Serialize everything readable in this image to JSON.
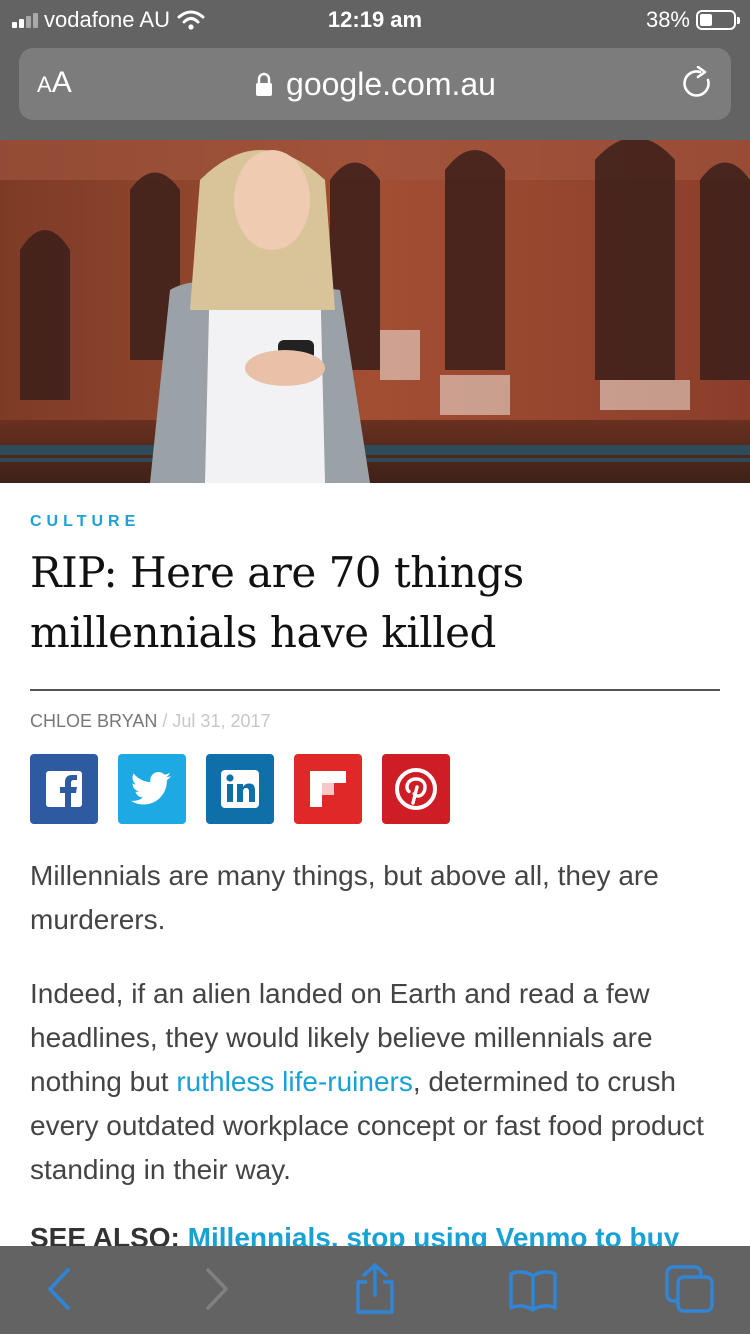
{
  "status_bar": {
    "carrier": "vodafone AU",
    "time": "12:19 am",
    "battery_percent": "38%",
    "battery_level": 0.38
  },
  "browser": {
    "aa_label_small": "A",
    "aa_label_big": "A",
    "url": "google.com.au"
  },
  "article": {
    "category": "CULTURE",
    "headline": "RIP: Here are 70 things millennials have killed",
    "author": "CHLOE BRYAN",
    "byline_separator": "/",
    "date": "Jul 31, 2017",
    "paragraph1": "Millennials are many things, but above all, they are murderers.",
    "paragraph2_before": "Indeed, if an alien landed on Earth and read a few headlines, they would likely believe millennials are nothing but ",
    "paragraph2_link": "ruthless life-ruiners",
    "paragraph2_after": ", determined to crush every outdated workplace concept or fast food product standing in their way.",
    "see_also_label": "SEE ALSO:",
    "see_also_link": "Millennials, stop using Venmo to buy"
  },
  "share": [
    {
      "name": "facebook",
      "color": "#2d5aa0",
      "icon": "facebook-icon"
    },
    {
      "name": "twitter",
      "color": "#1da9e3",
      "icon": "twitter-icon"
    },
    {
      "name": "linkedin",
      "color": "#0f6fa8",
      "icon": "linkedin-icon"
    },
    {
      "name": "flipboard",
      "color": "#e12828",
      "icon": "flipboard-icon"
    },
    {
      "name": "pinterest",
      "color": "#cf1d25",
      "icon": "pinterest-icon"
    }
  ],
  "colors": {
    "accent": "#1aa1d4",
    "browser_chrome": "#636363",
    "ios_blue": "#2f86d8"
  }
}
